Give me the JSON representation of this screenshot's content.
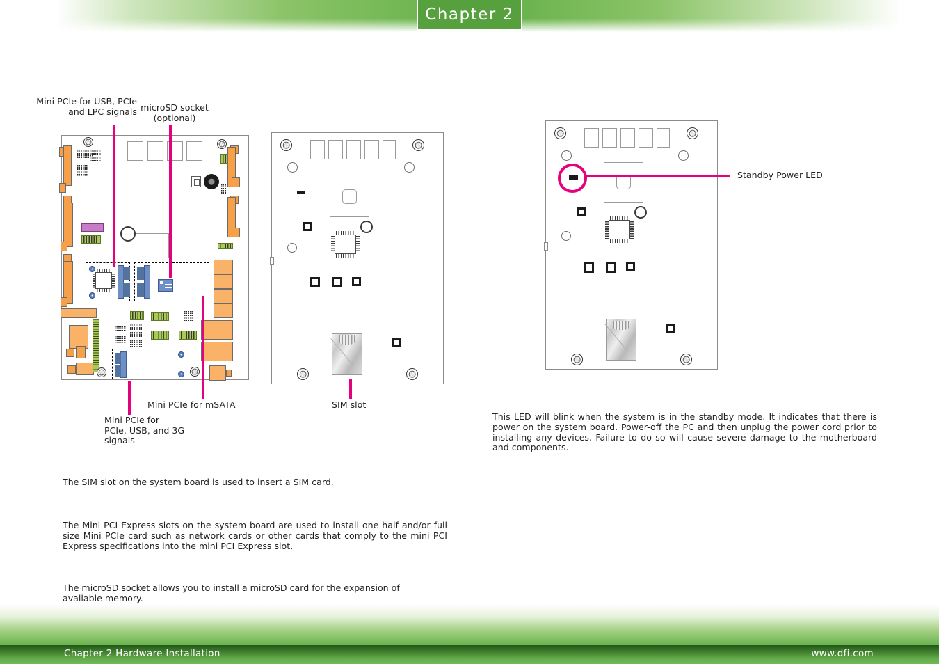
{
  "header": {
    "chapter_tab": "Chapter 2"
  },
  "footer": {
    "left": "Chapter 2 Hardware Installation",
    "right": "www.dfi.com"
  },
  "colors": {
    "accent_magenta": "#e5007d",
    "header_green": "#6cb44f",
    "tab_green": "#56a03d",
    "footer_dark_green": "#1e5418",
    "pcb_orange": "#f6a04a",
    "pcb_blue": "#6e8fc6",
    "pcb_green": "#a9cb56",
    "pcb_purple": "#c77cc6"
  },
  "callouts": {
    "mini_pcie_usb": "Mini PCIe for USB, PCIe\nand LPC signals",
    "microsd_socket": "microSD socket\n(optional)",
    "mini_pcie_msata": "Mini PCIe for mSATA",
    "mini_pcie_3g": "Mini PCIe for\nPCIe, USB, and 3G\nsignals",
    "sim_slot": "SIM slot",
    "standby_power_led": "Standby Power LED"
  },
  "paragraphs": {
    "sim": "The SIM slot on the system board is used to insert a SIM card.",
    "mini_pcie": "The Mini PCI Express slots on the system board are used to install one half and/or full size Mini PCIe card such as network cards or other cards that comply to the mini PCI Express specifications into the mini PCI Express slot.",
    "microsd": "The microSD socket allows you to install a microSD card for the expansion of available memory.",
    "standby_led": "This LED will blink when the system is in the standby mode. It indicates that there is power on the system board. Power-off the PC and then unplug the power cord prior to installing any devices. Failure to do so will cause severe damage to the motherboard and components."
  }
}
